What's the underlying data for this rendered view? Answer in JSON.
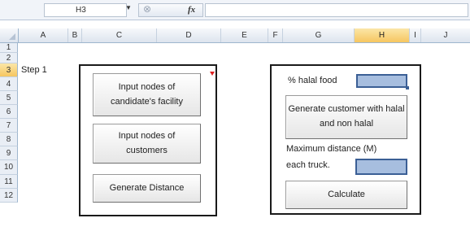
{
  "formula_bar": {
    "name_box": "H3",
    "fx_label": "fx",
    "formula": ""
  },
  "columns": [
    "A",
    "B",
    "C",
    "D",
    "E",
    "F",
    "G",
    "H",
    "I",
    "J"
  ],
  "selected_column": "H",
  "rows": [
    "1",
    "2",
    "3",
    "4",
    "5",
    "6",
    "7",
    "8",
    "9",
    "10",
    "11",
    "12"
  ],
  "selected_row": "3",
  "cells": {
    "a3": "Step 1",
    "halal_label": "% halal food",
    "max_distance_label_line1": "Maximum distance (M)",
    "max_distance_label_line2": "each truck."
  },
  "buttons": {
    "input_facility": "Input nodes of candidate's facility",
    "input_customers": "Input nodes of customers",
    "generate_distance": "Generate Distance",
    "generate_customer": "Generate customer with halal and non halal",
    "calculate": "Calculate"
  },
  "inputs": {
    "halal_percent": "",
    "max_distance": ""
  },
  "colors": {
    "selected_header": "#f6c660",
    "input_fill": "#a7bedf",
    "frame_border": "#1a1a1a"
  }
}
